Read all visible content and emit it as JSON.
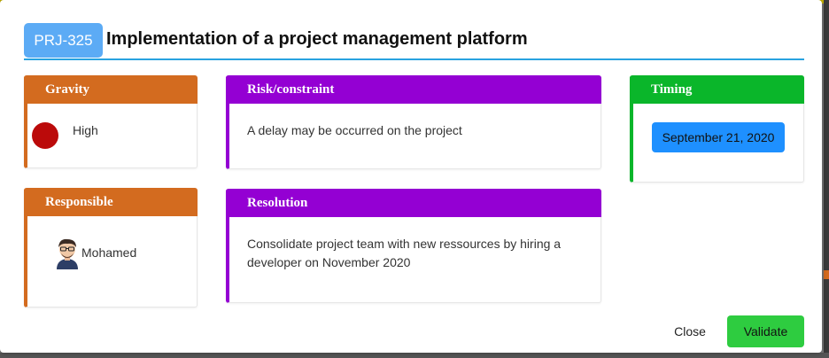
{
  "header": {
    "badge": "PRJ-325",
    "title": "Implementation of a project management platform"
  },
  "gravity": {
    "heading": "Gravity",
    "level": "High",
    "level_color": "#bb0a0a"
  },
  "risk": {
    "heading": "Risk/constraint",
    "text": "A delay may be occurred on the project"
  },
  "timing": {
    "heading": "Timing",
    "date": "September 21, 2020"
  },
  "responsible": {
    "heading": "Responsible",
    "name": "Mohamed",
    "avatar_icon": "user-avatar-icon"
  },
  "resolution": {
    "heading": "Resolution",
    "text": "Consolidate project team with new ressources by hiring a developer on November 2020"
  },
  "footer": {
    "close_label": "Close",
    "validate_label": "Validate"
  },
  "colors": {
    "badge": "#5cabf5",
    "orange": "#d36b1f",
    "purple": "#9400d3",
    "green": "#0ab62a",
    "date_pill": "#1e90ff",
    "validate": "#2ecc40",
    "divider": "#29a3e0"
  }
}
